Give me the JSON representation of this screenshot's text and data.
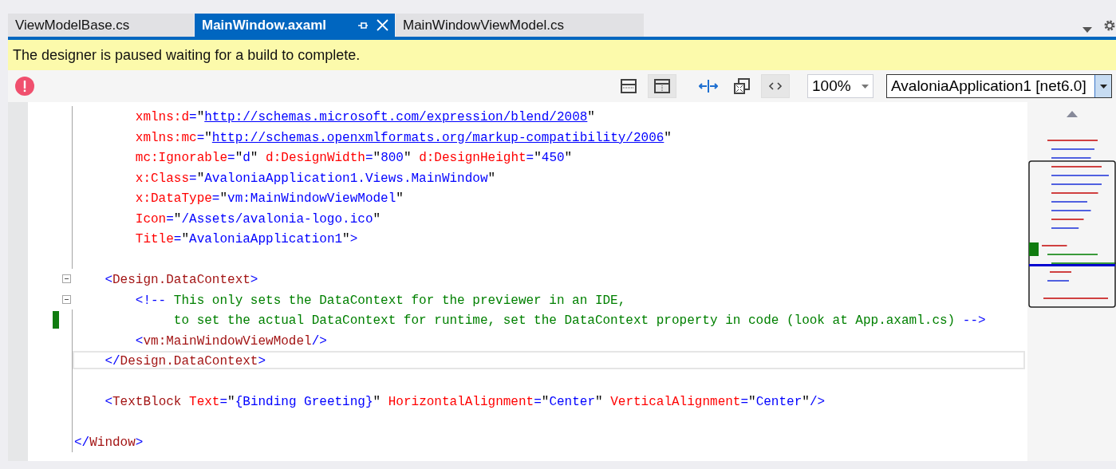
{
  "tabs": [
    {
      "label": "ViewModelBase.cs",
      "selected": false
    },
    {
      "label": "MainWindow.axaml",
      "selected": true
    },
    {
      "label": "MainWindowViewModel.cs",
      "selected": false
    }
  ],
  "info_bar": {
    "message": "The designer is paused waiting for a build to complete."
  },
  "toolbar": {
    "error": true,
    "buttons": [
      {
        "kind": "horizontal-split",
        "pressed": false
      },
      {
        "kind": "vertical-split",
        "pressed": true
      },
      {
        "kind": "swap",
        "pressed": false
      },
      {
        "kind": "fit",
        "pressed": false
      },
      {
        "kind": "code",
        "pressed": true
      }
    ],
    "zoom": "100%",
    "project": "AvaloniaApplication1 [net6.0]"
  },
  "editor": {
    "lines": [
      {
        "fold": false,
        "changed": false,
        "current": false,
        "text": "        xmlns:d=\"http://schemas.microsoft.com/expression/blend/2008\""
      },
      {
        "fold": false,
        "changed": false,
        "current": false,
        "text": "        xmlns:mc=\"http://schemas.openxmlformats.org/markup-compatibility/2006\""
      },
      {
        "fold": false,
        "changed": false,
        "current": false,
        "text": "        mc:Ignorable=\"d\" d:DesignWidth=\"800\" d:DesignHeight=\"450\""
      },
      {
        "fold": false,
        "changed": false,
        "current": false,
        "text": "        x:Class=\"AvaloniaApplication1.Views.MainWindow\""
      },
      {
        "fold": false,
        "changed": false,
        "current": false,
        "text": "        x:DataType=\"vm:MainWindowViewModel\""
      },
      {
        "fold": false,
        "changed": false,
        "current": false,
        "text": "        Icon=\"/Assets/avalonia-logo.ico\""
      },
      {
        "fold": false,
        "changed": false,
        "current": false,
        "text": "        Title=\"AvaloniaApplication1\">"
      },
      {
        "fold": false,
        "changed": false,
        "current": false
      },
      {
        "fold": true,
        "changed": false,
        "current": false,
        "text": "    <Design.DataContext>"
      },
      {
        "fold": true,
        "changed": false,
        "current": false,
        "text": "        <!-- This only sets the DataContext for the previewer in an IDE,"
      },
      {
        "fold": false,
        "changed": true,
        "current": false,
        "text": "             to set the actual DataContext for runtime, set the DataContext property in code (look at App.axaml.cs) -->"
      },
      {
        "fold": false,
        "changed": false,
        "current": false,
        "text": "        <vm:MainWindowViewModel/>"
      },
      {
        "fold": false,
        "changed": false,
        "current": true,
        "text": "    </Design.DataContext>"
      },
      {
        "fold": false,
        "changed": false,
        "current": false
      },
      {
        "fold": false,
        "changed": false,
        "current": false,
        "text": "    <TextBlock Text=\"{Binding Greeting}\" HorizontalAlignment=\"Center\" VerticalAlignment=\"Center\"/>"
      },
      {
        "fold": false,
        "changed": false,
        "current": false
      },
      {
        "fold": false,
        "changed": false,
        "current": false,
        "text": "</Window>"
      }
    ]
  }
}
